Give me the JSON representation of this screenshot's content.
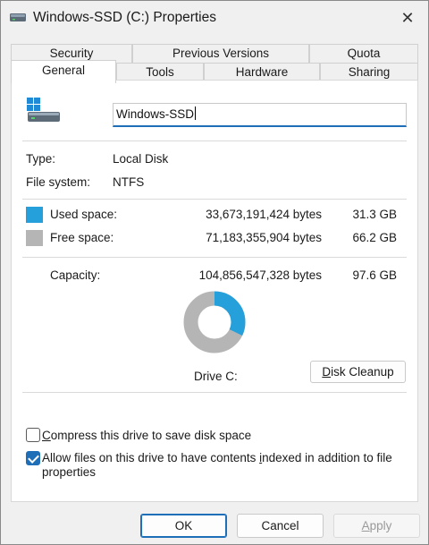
{
  "window": {
    "title": "Windows-SSD (C:) Properties",
    "close_glyph": "✕"
  },
  "tabs_back": [
    {
      "label": "Security"
    },
    {
      "label": "Previous Versions"
    },
    {
      "label": "Quota"
    }
  ],
  "tabs_front": [
    {
      "label": "General",
      "active": true
    },
    {
      "label": "Tools"
    },
    {
      "label": "Hardware"
    },
    {
      "label": "Sharing"
    }
  ],
  "general": {
    "drive_name_value": "Windows-SSD",
    "type_label": "Type:",
    "type_value": "Local Disk",
    "fs_label": "File system:",
    "fs_value": "NTFS",
    "used": {
      "label": "Used space:",
      "bytes": "33,673,191,424 bytes",
      "size": "31.3 GB",
      "color": "#26a0da"
    },
    "free": {
      "label": "Free space:",
      "bytes": "71,183,355,904 bytes",
      "size": "66.2 GB",
      "color": "#b5b5b5"
    },
    "capacity": {
      "label": "Capacity:",
      "bytes": "104,856,547,328 bytes",
      "size": "97.6 GB"
    },
    "used_fraction": 0.321,
    "drive_label": "Drive C:",
    "disk_cleanup_prefix": "",
    "disk_cleanup_accel": "D",
    "disk_cleanup_rest": "isk Cleanup",
    "compress": {
      "checked": false,
      "accel": "C",
      "rest": "ompress this drive to save disk space"
    },
    "index": {
      "checked": true,
      "before": "Allow files on this drive to have contents ",
      "accel": "i",
      "after": "ndexed in addition to file properties"
    }
  },
  "footer": {
    "ok": "OK",
    "cancel": "Cancel",
    "apply_accel": "A",
    "apply_rest": "pply"
  }
}
